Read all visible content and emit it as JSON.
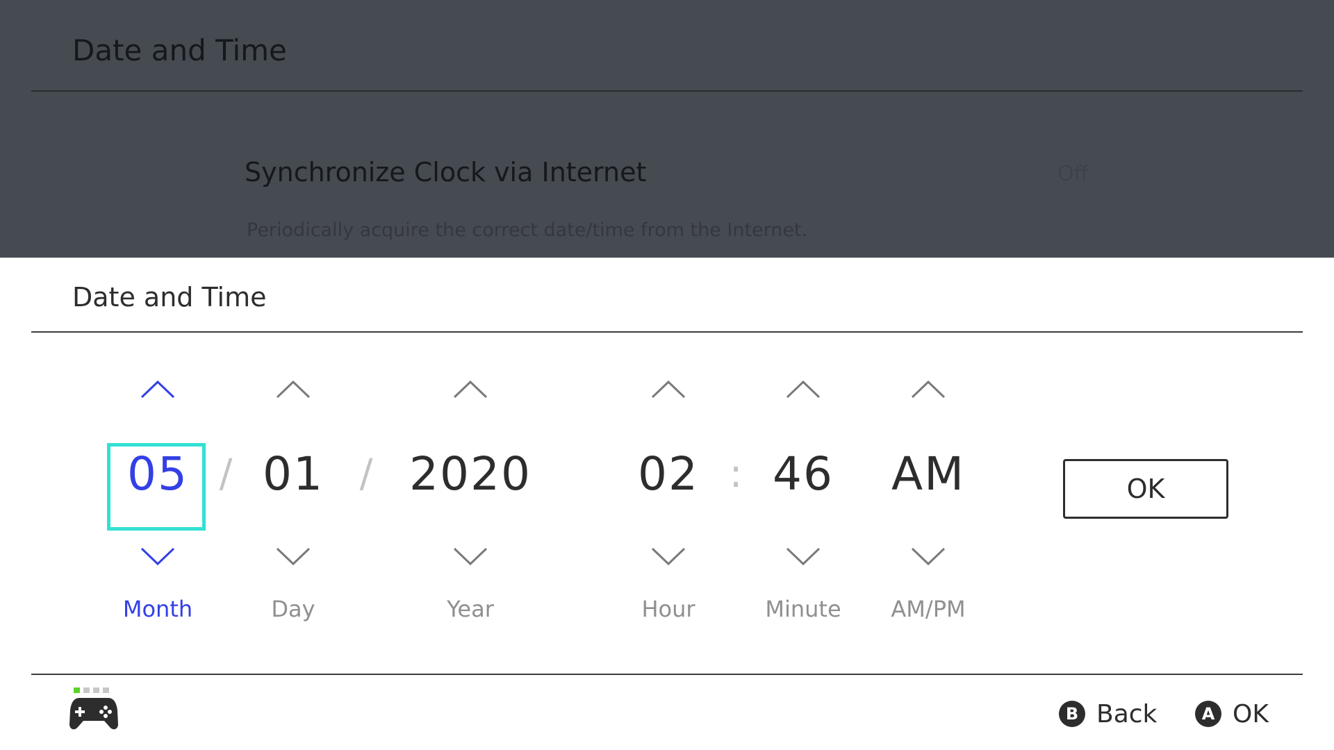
{
  "background": {
    "title": "Date and Time",
    "setting_label": "Synchronize Clock via Internet",
    "setting_value": "Off",
    "setting_description": "Periodically acquire the correct date/time from the Internet."
  },
  "dialog": {
    "title": "Date and Time",
    "fields": {
      "month": {
        "value": "05",
        "label": "Month"
      },
      "day": {
        "value": "01",
        "label": "Day"
      },
      "year": {
        "value": "2020",
        "label": "Year"
      },
      "hour": {
        "value": "02",
        "label": "Hour"
      },
      "minute": {
        "value": "46",
        "label": "Minute"
      },
      "ampm": {
        "value": "AM",
        "label": "AM/PM"
      }
    },
    "date_separator": "/",
    "time_separator": ":",
    "ok_label": "OK",
    "selected_field": "month"
  },
  "footer": {
    "back_button": "B",
    "back_label": "Back",
    "ok_button": "A",
    "ok_label": "OK",
    "controller_icon": "controller-icon",
    "player_indicator": 1
  },
  "colors": {
    "accent": "#3340e6",
    "selection_border": "#32e0d4",
    "overlay_background": "#464b52",
    "player_led": "#5ad32a"
  }
}
